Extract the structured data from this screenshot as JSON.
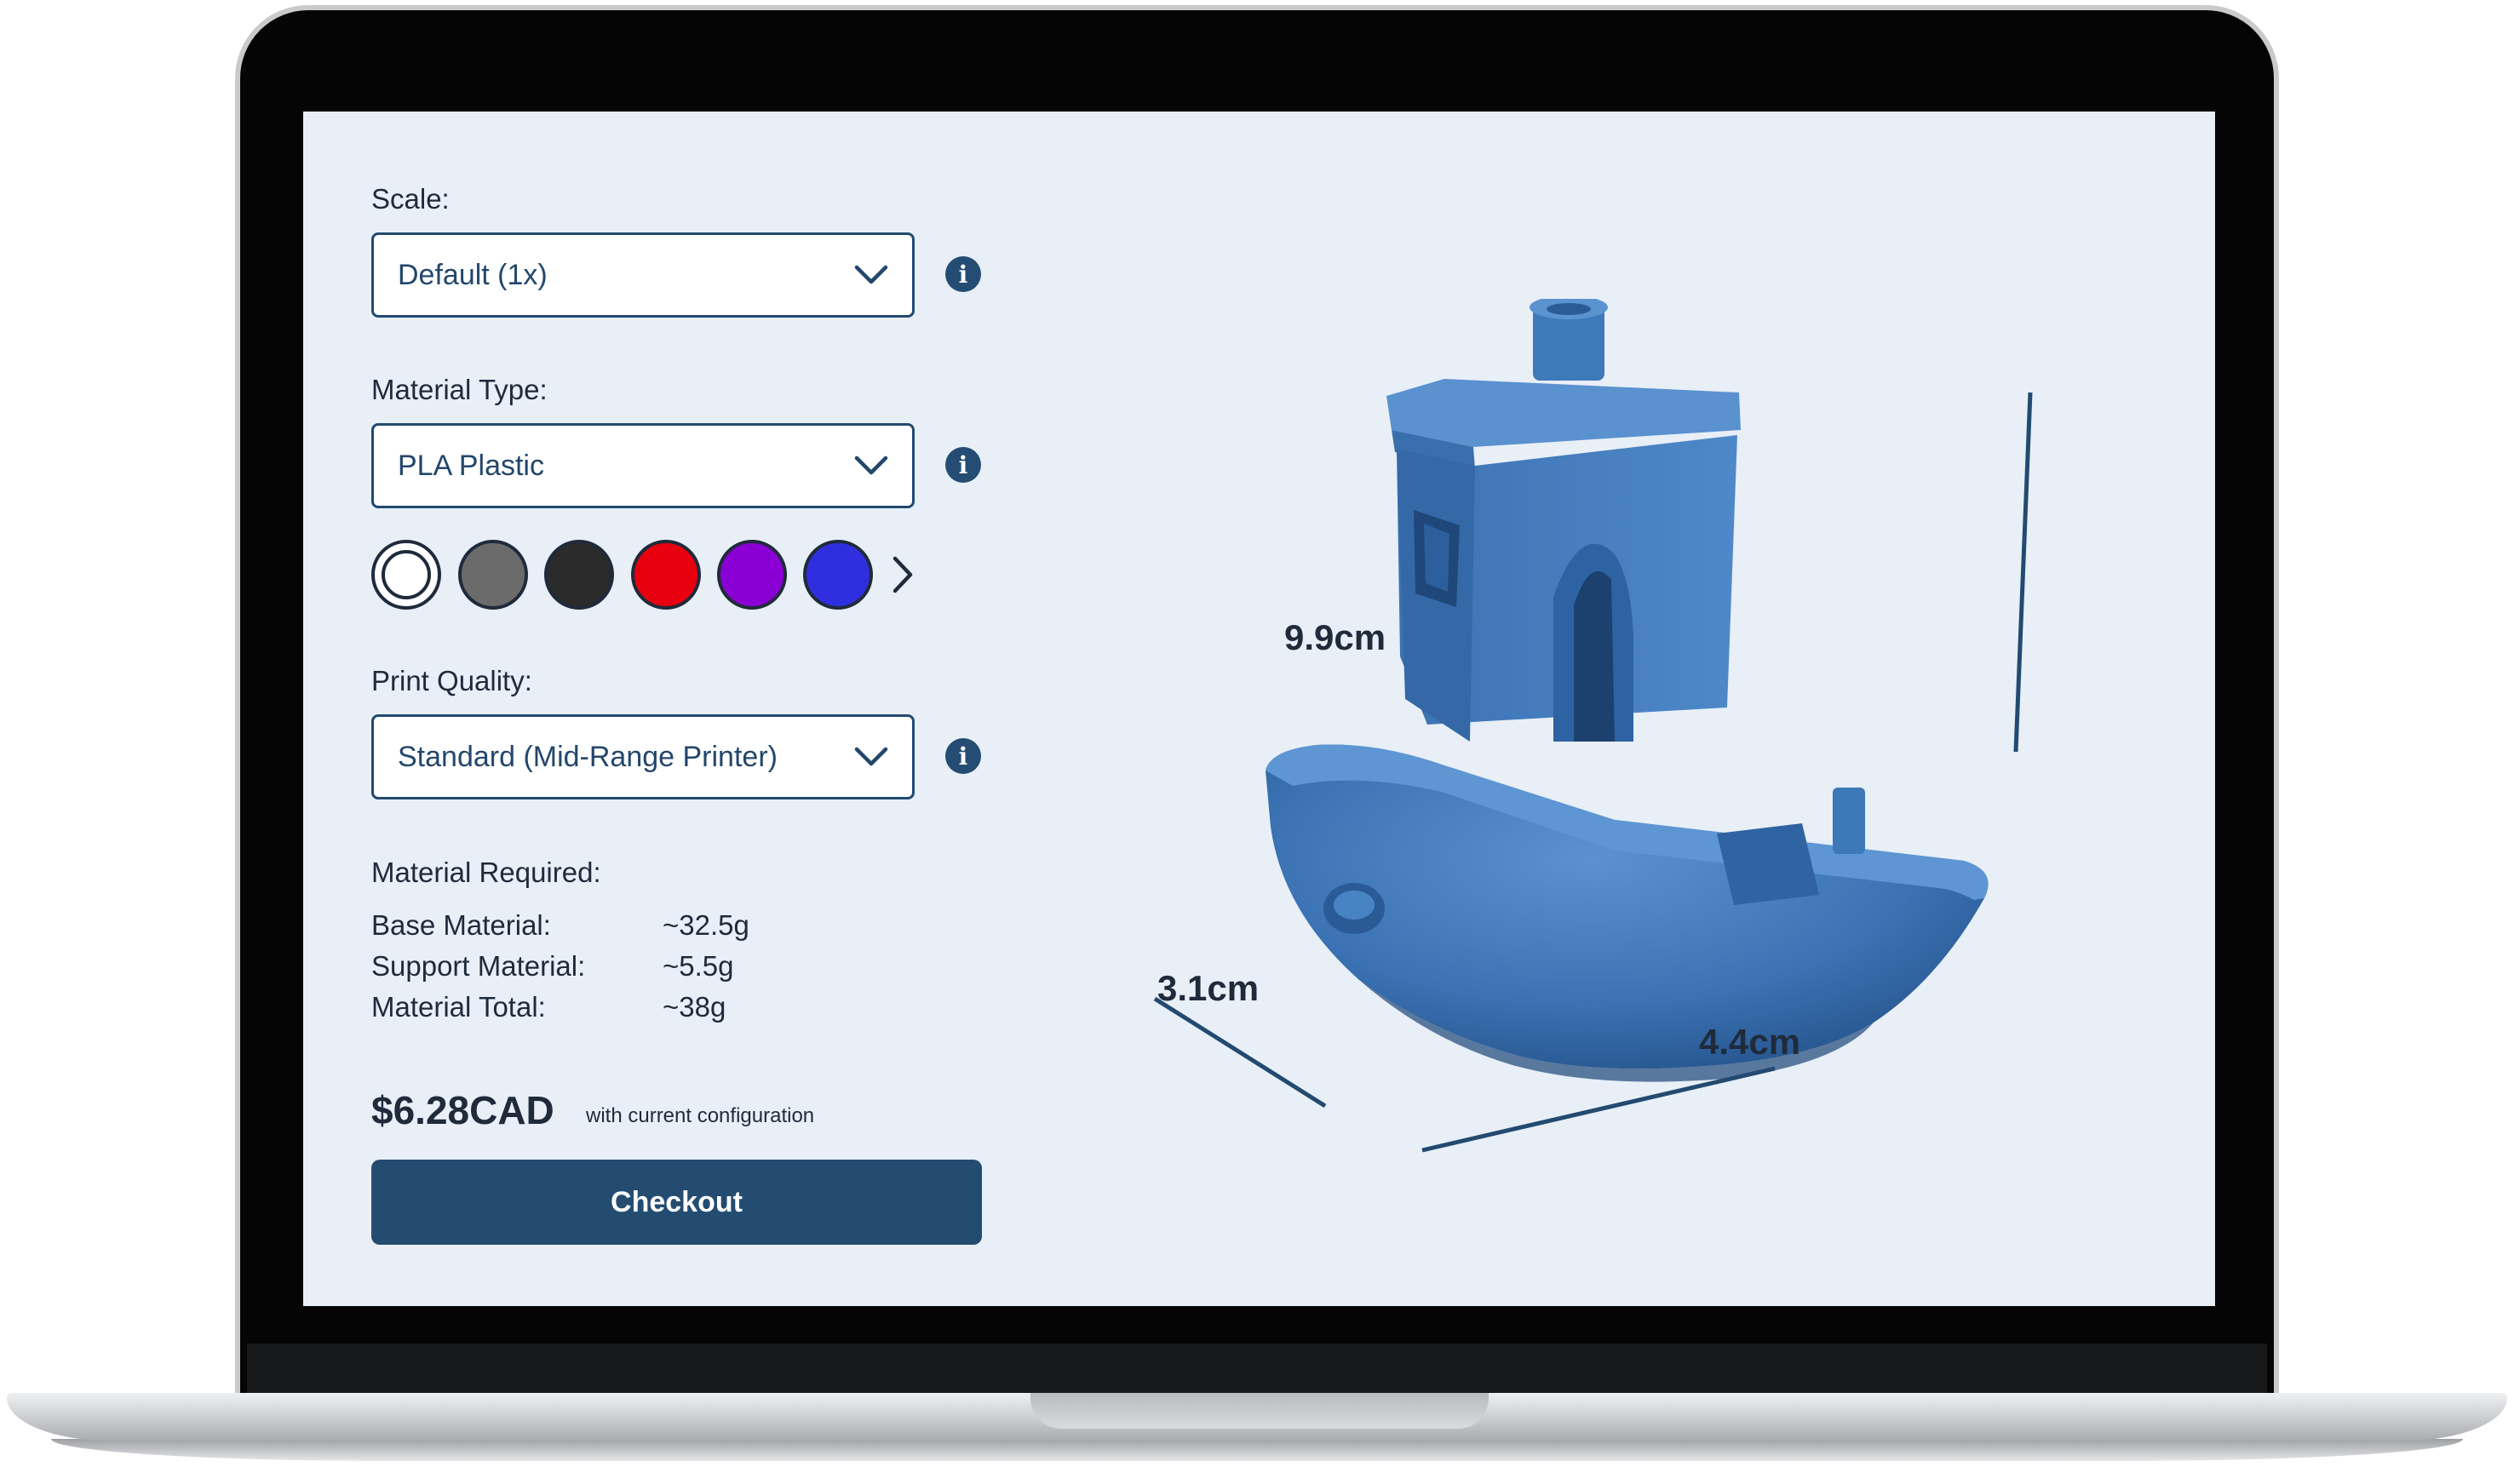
{
  "config": {
    "scale": {
      "label": "Scale:",
      "value": "Default (1x)"
    },
    "material_type": {
      "label": "Material Type:",
      "value": "PLA Plastic"
    },
    "print_quality": {
      "label": "Print Quality:",
      "value": "Standard (Mid-Range Printer)"
    },
    "colors": [
      {
        "name": "white",
        "hex": "#ffffff",
        "selected": true
      },
      {
        "name": "gray",
        "hex": "#6b6b6b"
      },
      {
        "name": "black",
        "hex": "#2b2b2b"
      },
      {
        "name": "red",
        "hex": "#e8000e"
      },
      {
        "name": "purple",
        "hex": "#8a00d4"
      },
      {
        "name": "blue",
        "hex": "#2f2fe0"
      }
    ],
    "info_icon": "i"
  },
  "material": {
    "heading": "Material Required:",
    "rows": [
      {
        "label": "Base Material:",
        "value": "~32.5g"
      },
      {
        "label": "Support Material:",
        "value": "~5.5g"
      },
      {
        "label": "Material Total:",
        "value": "~38g"
      }
    ]
  },
  "price": {
    "amount": "$6.28CAD",
    "note": "with current configuration"
  },
  "checkout_label": "Checkout",
  "model": {
    "color": "#3d78bb",
    "dimensions": {
      "height": "9.9cm",
      "depth": "3.1cm",
      "width": "4.4cm"
    }
  },
  "theme": {
    "accent": "#244c71",
    "screen_bg": "#e8eff7",
    "text": "#1f2b3b"
  }
}
